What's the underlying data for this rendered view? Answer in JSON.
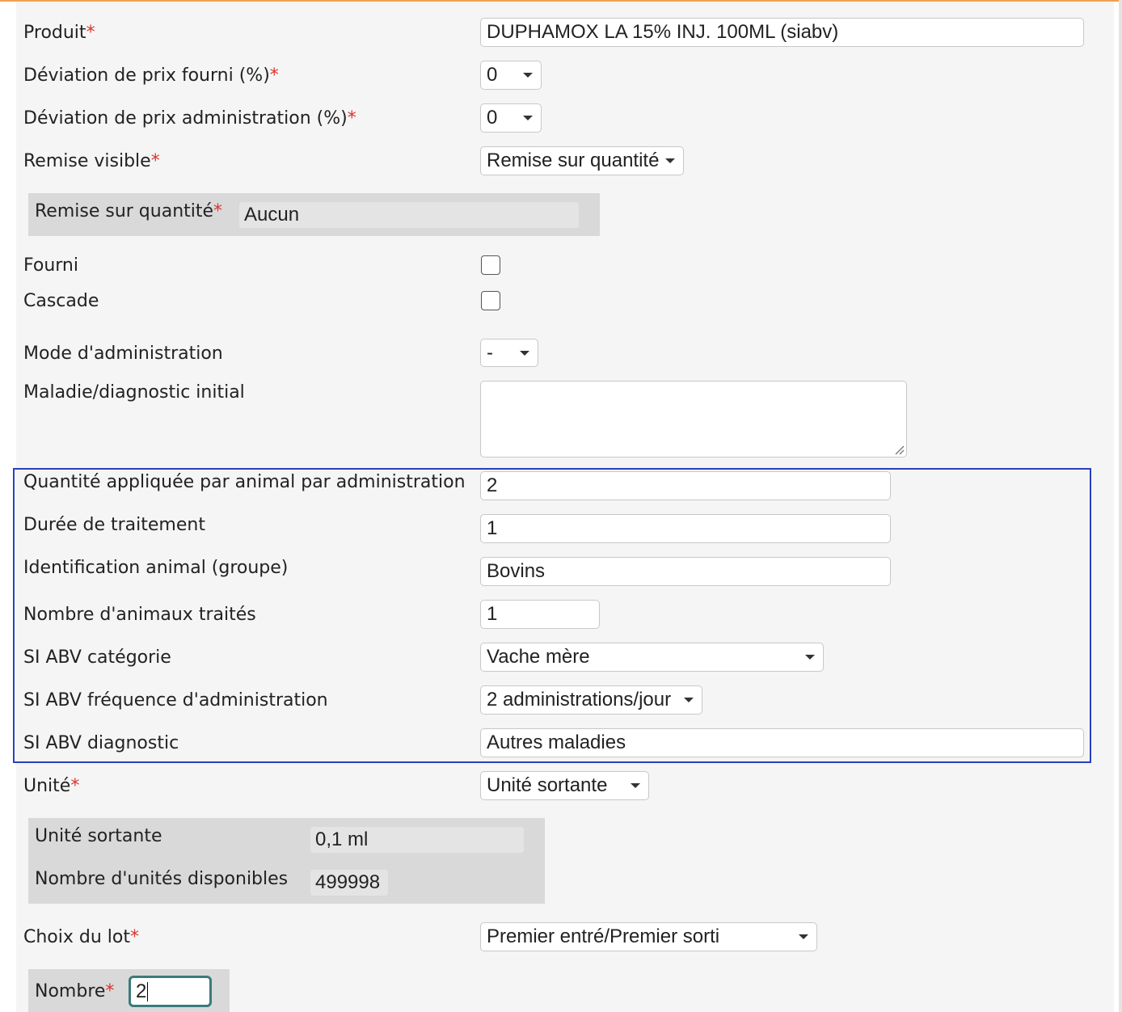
{
  "form": {
    "produit": {
      "label": "Produit",
      "required_mark": "*",
      "value": "DUPHAMOX LA 15% INJ. 100ML (siabv)"
    },
    "deviation_fourni": {
      "label": "Déviation de prix fourni (%)",
      "required_mark": "*",
      "value": "0"
    },
    "deviation_admin": {
      "label": "Déviation de prix administration (%)",
      "required_mark": "*",
      "value": "0"
    },
    "remise_visible": {
      "label": "Remise visible",
      "required_mark": "*",
      "value": "Remise sur quantité"
    },
    "remise_quantite": {
      "label": "Remise sur quantité",
      "required_mark": "*",
      "value": "Aucun"
    },
    "fourni": {
      "label": "Fourni",
      "checked": false
    },
    "cascade": {
      "label": "Cascade",
      "checked": false
    },
    "mode_admin": {
      "label": "Mode d'administration",
      "value": "-"
    },
    "maladie": {
      "label": "Maladie/diagnostic initial",
      "value": ""
    },
    "quantite": {
      "label": "Quantité appliquée par animal par administration",
      "value": "2"
    },
    "duree": {
      "label": "Durée de traitement",
      "value": "1"
    },
    "identification": {
      "label": "Identification animal (groupe)",
      "value": "Bovins"
    },
    "nombre_animaux": {
      "label": "Nombre d'animaux traités",
      "value": "1"
    },
    "abv_categorie": {
      "label": "SI ABV catégorie",
      "value": "Vache mère"
    },
    "abv_frequence": {
      "label": "SI ABV fréquence d'administration",
      "value": "2 administrations/jour"
    },
    "abv_diagnostic": {
      "label": "SI ABV diagnostic",
      "value": "Autres maladies"
    },
    "unite": {
      "label": "Unité",
      "required_mark": "*",
      "value": "Unité sortante"
    },
    "unite_sortante": {
      "label": "Unité sortante",
      "value": "0,1 ml"
    },
    "nombre_unites": {
      "label": "Nombre d'unités disponibles",
      "value": "499998"
    },
    "choix_lot": {
      "label": "Choix du lot",
      "required_mark": "*",
      "value": "Premier entré/Premier sorti"
    },
    "nombre": {
      "label": "Nombre",
      "required_mark": "*",
      "value": "2"
    }
  },
  "colors": {
    "required": "#d9352f",
    "highlight_border": "#2a3fbf",
    "focus_border": "#3d7a7a",
    "top_accent": "#f0a050"
  }
}
